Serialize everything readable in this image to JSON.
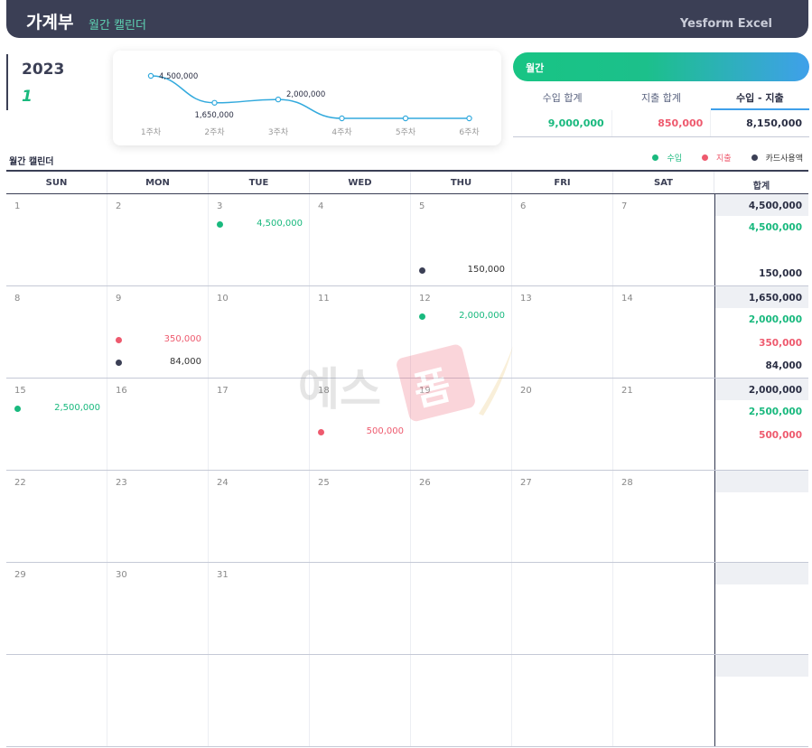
{
  "header": {
    "title": "가계부",
    "subtitle": "월간 캘린더",
    "brand": "Yesform Excel"
  },
  "period": {
    "year": "2023",
    "month": "1"
  },
  "colors": {
    "income": "#19b97e",
    "expense": "#ee5a6e",
    "card": "#3b3f55",
    "line": "#33aadd"
  },
  "chart_data": {
    "type": "line",
    "categories": [
      "1주차",
      "2주차",
      "3주차",
      "4주차",
      "5주차",
      "6주차"
    ],
    "values": [
      4500000,
      1650000,
      2000000,
      0,
      0,
      0
    ],
    "data_labels": [
      "4,500,000",
      "1,650,000",
      "2,000,000",
      "",
      "",
      ""
    ],
    "ylim": [
      0,
      4500000
    ]
  },
  "summary": {
    "pill_label": "월간",
    "headers": [
      "수입 합계",
      "지출 합계",
      "수입 - 지출"
    ],
    "values": [
      "9,000,000",
      "850,000",
      "8,150,000"
    ]
  },
  "calendar": {
    "label": "월간 캘린더",
    "legend": [
      {
        "label": "수입",
        "color": "#19b97e"
      },
      {
        "label": "지출",
        "color": "#ee5a6e"
      },
      {
        "label": "카드사용액",
        "color": "#3b3f55"
      }
    ],
    "day_headers": [
      "SUN",
      "MON",
      "TUE",
      "WED",
      "THU",
      "FRI",
      "SAT",
      "합계"
    ],
    "weeks": [
      {
        "days": [
          {
            "num": "1",
            "entries": []
          },
          {
            "num": "2",
            "entries": []
          },
          {
            "num": "3",
            "entries": [
              {
                "type": "income",
                "row": 1,
                "amount": "4,500,000"
              }
            ]
          },
          {
            "num": "4",
            "entries": []
          },
          {
            "num": "5",
            "entries": [
              {
                "type": "card",
                "row": 3,
                "amount": "150,000"
              }
            ]
          },
          {
            "num": "6",
            "entries": []
          },
          {
            "num": "7",
            "entries": []
          }
        ],
        "totals": [
          "4,500,000",
          "4,500,000",
          "",
          "150,000"
        ]
      },
      {
        "days": [
          {
            "num": "8",
            "entries": []
          },
          {
            "num": "9",
            "entries": [
              {
                "type": "expense",
                "row": 2,
                "amount": "350,000"
              },
              {
                "type": "card",
                "row": 3,
                "amount": "84,000"
              }
            ]
          },
          {
            "num": "10",
            "entries": []
          },
          {
            "num": "11",
            "entries": []
          },
          {
            "num": "12",
            "entries": [
              {
                "type": "income",
                "row": 1,
                "amount": "2,000,000"
              }
            ]
          },
          {
            "num": "13",
            "entries": []
          },
          {
            "num": "14",
            "entries": []
          }
        ],
        "totals": [
          "1,650,000",
          "2,000,000",
          "350,000",
          "84,000"
        ]
      },
      {
        "days": [
          {
            "num": "15",
            "entries": [
              {
                "type": "income",
                "row": 1,
                "amount": "2,500,000"
              }
            ]
          },
          {
            "num": "16",
            "entries": []
          },
          {
            "num": "17",
            "entries": []
          },
          {
            "num": "18",
            "entries": [
              {
                "type": "expense",
                "row": 2,
                "amount": "500,000"
              }
            ]
          },
          {
            "num": "19",
            "entries": []
          },
          {
            "num": "20",
            "entries": []
          },
          {
            "num": "21",
            "entries": []
          }
        ],
        "totals": [
          "2,000,000",
          "2,500,000",
          "500,000",
          ""
        ]
      },
      {
        "days": [
          {
            "num": "22",
            "entries": []
          },
          {
            "num": "23",
            "entries": []
          },
          {
            "num": "24",
            "entries": []
          },
          {
            "num": "25",
            "entries": []
          },
          {
            "num": "26",
            "entries": []
          },
          {
            "num": "27",
            "entries": []
          },
          {
            "num": "28",
            "entries": []
          }
        ],
        "totals": [
          "",
          "",
          "",
          ""
        ]
      },
      {
        "days": [
          {
            "num": "29",
            "entries": []
          },
          {
            "num": "30",
            "entries": []
          },
          {
            "num": "31",
            "entries": []
          },
          {
            "num": "",
            "entries": []
          },
          {
            "num": "",
            "entries": []
          },
          {
            "num": "",
            "entries": []
          },
          {
            "num": "",
            "entries": []
          }
        ],
        "totals": [
          "",
          "",
          "",
          ""
        ]
      },
      {
        "days": [
          {
            "num": "",
            "entries": []
          },
          {
            "num": "",
            "entries": []
          },
          {
            "num": "",
            "entries": []
          },
          {
            "num": "",
            "entries": []
          },
          {
            "num": "",
            "entries": []
          },
          {
            "num": "",
            "entries": []
          },
          {
            "num": "",
            "entries": []
          }
        ],
        "totals": [
          "",
          "",
          "",
          ""
        ]
      }
    ]
  },
  "watermark": {
    "text": "예스폼"
  }
}
